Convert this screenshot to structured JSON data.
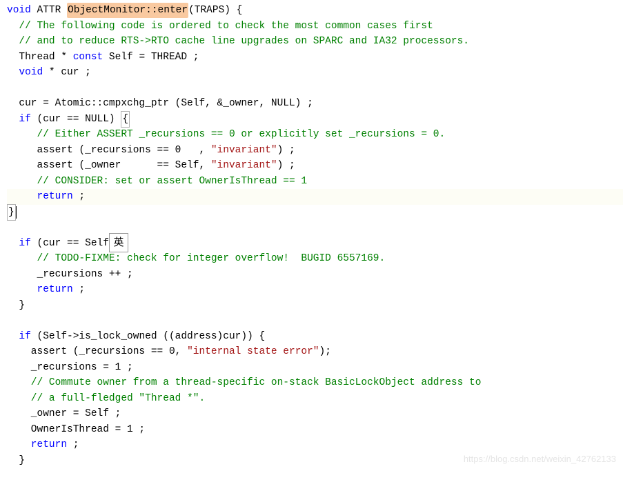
{
  "code": {
    "l1_void": "void",
    "l1_attr": " ATTR ",
    "l1_fn": "ObjectMonitor::enter",
    "l1_rest": "(TRAPS) {",
    "l2": "  // The following code is ordered to check the most common cases first",
    "l3": "  // and to reduce RTS->RTO cache line upgrades on SPARC and IA32 processors.",
    "l4_a": "  Thread * ",
    "l4_const": "const",
    "l4_b": " Self = THREAD ;",
    "l5_void": "  void",
    "l5_b": " * cur ;",
    "l6": "",
    "l7": "  cur = Atomic::cmpxchg_ptr (Self, &_owner, NULL) ;",
    "l8_if": "  if",
    "l8_b": " (cur == NULL) ",
    "l8_brace": "{",
    "l9": "     // Either ASSERT _recursions == 0 or explicitly set _recursions = 0.",
    "l10_a": "     assert (_recursions == ",
    "l10_num": "0",
    "l10_b": "   , ",
    "l10_str": "\"invariant\"",
    "l10_c": ") ;",
    "l11_a": "     assert (_owner      == Self, ",
    "l11_str": "\"invariant\"",
    "l11_b": ") ;",
    "l12": "     // CONSIDER: set or assert OwnerIsThread == 1",
    "l13_ret": "     return",
    "l13_b": " ;",
    "l14_brace": "}",
    "l15": "",
    "l16_if": "  if",
    "l16_b": " (cur == Self) {",
    "l17": "     // TODO-FIXME: check for integer overflow!  BUGID 6557169.",
    "l18": "     _recursions ++ ;",
    "l19_ret": "     return",
    "l19_b": " ;",
    "l20": "  }",
    "l21": "",
    "l22_if": "  if",
    "l22_b": " (Self->is_lock_owned ((address)cur)) {",
    "l23_a": "    assert (_recursions == ",
    "l23_num": "0",
    "l23_b": ", ",
    "l23_str": "\"internal state error\"",
    "l23_c": ");",
    "l24_a": "    _recursions = ",
    "l24_num": "1",
    "l24_b": " ;",
    "l25": "    // Commute owner from a thread-specific on-stack BasicLockObject address to",
    "l26": "    // a full-fledged \"Thread *\".",
    "l27": "    _owner = Self ;",
    "l28_a": "    OwnerIsThread = ",
    "l28_num": "1",
    "l28_b": " ;",
    "l29_ret": "    return",
    "l29_b": " ;",
    "l30": "  }"
  },
  "ime": "英",
  "watermark": "https://blog.csdn.net/weixin_42762133"
}
